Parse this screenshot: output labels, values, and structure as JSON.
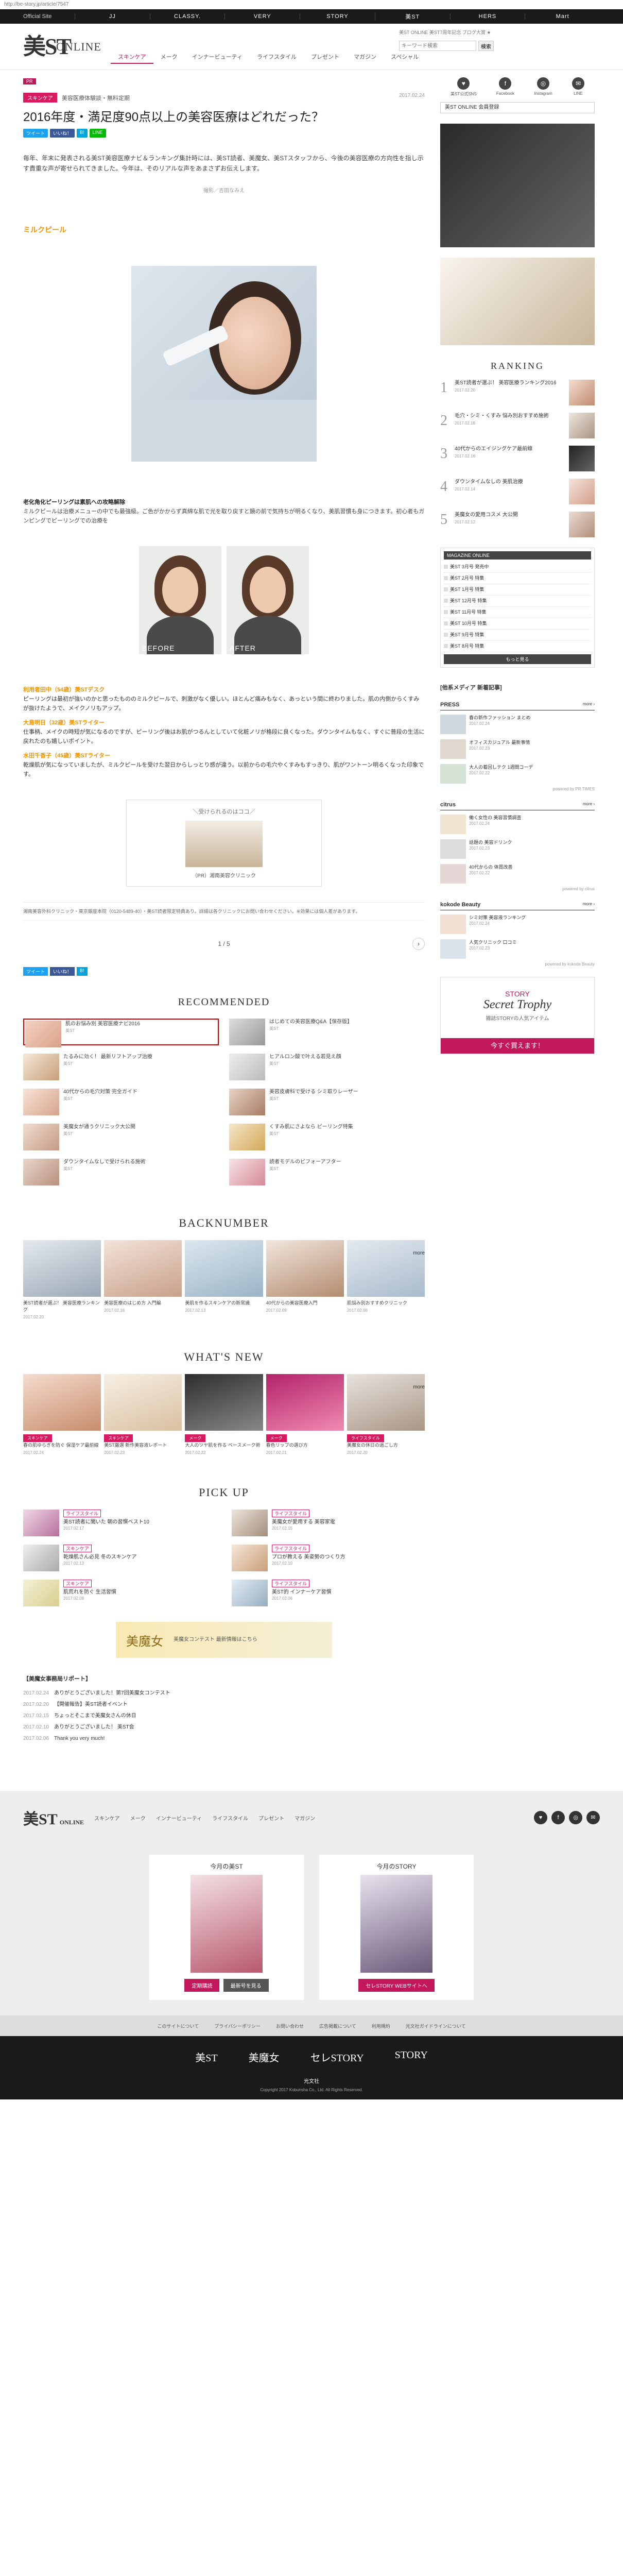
{
  "url": "http://be-story.jp/article/7547",
  "globalnav": {
    "official": "Official Site",
    "items": [
      "JJ",
      "CLASSY.",
      "VERY",
      "STORY",
      "美ST",
      "HERS",
      "Mart"
    ]
  },
  "header": {
    "logo_main": "美ST",
    "logo_sub": "ONLINE",
    "tagline": "美ST ONLINE 美ST7周年記念 ブログ大賞 ★",
    "nav": [
      "スキンケア",
      "メーク",
      "インナービューティ",
      "ライフスタイル",
      "プレゼント",
      "マガジン",
      "スペシャル"
    ],
    "search_placeholder": "キーワード検索",
    "search_button": "検索"
  },
  "article": {
    "badge": "PR",
    "category": "スキンケア",
    "category_sub": "美容医療体験談・無料定期",
    "date": "2017.02.24",
    "title": "2016年度・満足度90点以上の美容医療はどれだった？",
    "share": [
      "ツイート",
      "いいね！",
      "B!",
      "LINE"
    ],
    "lead": "毎年、年末に発表される美ST美容医療ナビ＆ランキング集計時には、美ST読者、美魔女、美STスタッフから、今後の美容医療の方向性を指し示す貴重な声が寄せられてきました。今年は、そのリアルな声をあまさずお伝えします。",
    "credit": "撮影／吉田なみえ",
    "section": "ミルクピール",
    "body_head": "老化角化ピーリングは素肌への攻略解除",
    "body": "ミルクピールは治療メニューの中でも最強級。ご色がかからず真綿な肌で光を取り戻すと鏡の前で気持ちが明るくなり、美肌習慣も身につきます。初心者もガンピングでピーリングでの治療を",
    "before": "BEFORE",
    "after": "AFTER",
    "comments": [
      {
        "who": "利用者田中（54歳）美STデスク",
        "text": "ピーリングは最初が強いのかと思ったもののミルクピールで、刺激がなく優しい。ほとんど痛みもなく、あっという間に終わりました。肌の内側からくすみが抜けたようで、メイクノリもアップ。"
      },
      {
        "who": "大島明日（32歳）美STライター",
        "text": "仕事柄、メイクの時短が気になるのですが、ピーリング後はお肌がつるんとしていて化粧ノリが格段に良くなった。ダウンタイムもなく、すぐに普段の生活に戻れたのも嬉しいポイント。"
      },
      {
        "who": "水田千香子（45歳）美STライター",
        "text": "乾燥肌が気になっていましたが、ミルクピールを受けた翌日からしっとり感が違う。以前からの毛穴やくすみもすっきり、肌がワントーン明るくなった印象です。"
      }
    ],
    "clinic_title": "＼受けられるのはココ／",
    "clinic_name": "（PR）湘南美容クリニック",
    "note": "湘南美容外科クリニック・東京銀座本院（0120-5489-40）・美ST読者限定特典あり。詳細は各クリニックにお問い合わせください。※効果には個人差があります。",
    "page": "1 / 5"
  },
  "recommended": {
    "title": "RECOMMENDED",
    "items": [
      {
        "text": "肌のお悩み別 美容医療ナビ2016",
        "src": "美ST"
      },
      {
        "text": "はじめての美容医療Q&A【保存版】",
        "src": "美ST"
      },
      {
        "text": "たるみに効く！ 最新リフトアップ治療",
        "src": "美ST"
      },
      {
        "text": "ヒアルロン酸で叶える若見え顔",
        "src": "美ST"
      },
      {
        "text": "40代からの毛穴対策 完全ガイド",
        "src": "美ST"
      },
      {
        "text": "美容皮膚科で受ける シミ取りレーザー",
        "src": "美ST"
      },
      {
        "text": "美魔女が通うクリニック大公開",
        "src": "美ST"
      },
      {
        "text": "くすみ肌にさよなら ピーリング特集",
        "src": "美ST"
      },
      {
        "text": "ダウンタイムなしで受けられる施術",
        "src": "美ST"
      },
      {
        "text": "読者モデルのビフォーアフター",
        "src": "美ST"
      }
    ]
  },
  "backnumber": {
    "title": "BACKNUMBER",
    "more": "more",
    "items": [
      {
        "text": "美ST読者が選ぶ！ 美容医療ランキング",
        "date": "2017.02.20"
      },
      {
        "text": "美容医療のはじめ方 入門編",
        "date": "2017.02.16"
      },
      {
        "text": "美肌を作るスキンケアの新常識",
        "date": "2017.02.13"
      },
      {
        "text": "40代からの美容医療入門",
        "date": "2017.02.09"
      },
      {
        "text": "肌悩み別おすすめクリニック",
        "date": "2017.02.06"
      }
    ]
  },
  "whatsnew": {
    "title": "WHAT'S NEW",
    "more": "more",
    "items": [
      {
        "label": "スキンケア",
        "text": "春の肌ゆらぎを防ぐ 保湿ケア最前線",
        "date": "2017.02.24"
      },
      {
        "label": "スキンケア",
        "text": "美ST厳選 新作美容液レポート",
        "date": "2017.02.23"
      },
      {
        "label": "メーク",
        "text": "大人のツヤ肌を作る ベースメーク術",
        "date": "2017.02.22"
      },
      {
        "label": "メーク",
        "text": "春色リップの選び方",
        "date": "2017.02.21"
      },
      {
        "label": "ライフスタイル",
        "text": "美魔女の休日の過ごし方",
        "date": "2017.02.20"
      }
    ]
  },
  "pickup": {
    "title": "PICK UP",
    "items": [
      {
        "label": "ライフスタイル",
        "text": "美ST読者に聞いた 朝の習慣ベスト10",
        "date": "2017.02.17"
      },
      {
        "label": "ライフスタイル",
        "text": "美魔女が愛用する 美容家電",
        "date": "2017.02.15"
      },
      {
        "label": "スキンケア",
        "text": "乾燥肌さん必見 冬のスキンケア",
        "date": "2017.02.13"
      },
      {
        "label": "ライフスタイル",
        "text": "プロが教える 美姿勢のつくり方",
        "date": "2017.02.10"
      },
      {
        "label": "スキンケア",
        "text": "肌荒れを防ぐ 生活習慣",
        "date": "2017.02.08"
      },
      {
        "label": "ライフスタイル",
        "text": "美ST的 インナーケア習慣",
        "date": "2017.02.06"
      }
    ]
  },
  "banner": {
    "logo": "美魔女",
    "text": "美魔女コンテスト 最新情報はこちら"
  },
  "news": {
    "title": "【美魔女事務局リポート】",
    "items": [
      {
        "date": "2017.02.24",
        "text": "ありがとうございました！第7回美魔女コンテスト"
      },
      {
        "date": "2017.02.20",
        "text": "【開催報告】美ST読者イベント"
      },
      {
        "date": "2017.02.15",
        "text": "ちょっとそこまで美魔女さんの休日"
      },
      {
        "date": "2017.02.10",
        "text": "ありがとうございました！ 美ST会"
      },
      {
        "date": "2017.02.06",
        "text": "Thank you very much!"
      }
    ]
  },
  "sidebar": {
    "nav": [
      {
        "icon": "♥",
        "label": "美ST公式SNS"
      },
      {
        "icon": "f",
        "label": "Facebook"
      },
      {
        "icon": "◎",
        "label": "Instagram"
      },
      {
        "icon": "✉",
        "label": "LINE"
      }
    ],
    "subscribe": "美ST ONLINE 会員登録",
    "ranking_title": "RANKING",
    "ranking": [
      {
        "n": "1",
        "text": "美ST読者が選ぶ！ 美容医療ランキング2016",
        "date": "2017.02.20"
      },
      {
        "n": "2",
        "text": "毛穴・シミ・くすみ 悩み別おすすめ施術",
        "date": "2017.02.18"
      },
      {
        "n": "3",
        "text": "40代からのエイジングケア最前線",
        "date": "2017.02.16"
      },
      {
        "n": "4",
        "text": "ダウンタイムなしの 美肌治療",
        "date": "2017.02.14"
      },
      {
        "n": "5",
        "text": "美魔女の愛用コスメ 大公開",
        "date": "2017.02.12"
      }
    ],
    "box_title": "MAGAZINE ONLINE",
    "box_items": [
      "美ST 3月号 発売中",
      "美ST 2月号 特集",
      "美ST 1月号 特集",
      "美ST 12月号 特集",
      "美ST 11月号 特集",
      "美ST 10月号 特集",
      "美ST 9月号 特集",
      "美ST 8月号 特集"
    ],
    "box_more": "もっと見る",
    "media_title": "[他系メディア 新着記事]",
    "press_title": "PRESS",
    "press_items": [
      {
        "text": "春の新作ファッション まとめ",
        "date": "2017.02.24"
      },
      {
        "text": "オフィスカジュアル 最新事情",
        "date": "2017.02.23"
      },
      {
        "text": "大人の着回しテク 1週間コーデ",
        "date": "2017.02.22"
      }
    ],
    "press_powered": "powered by PR TIMES",
    "citrus_title": "citrus",
    "citrus_items": [
      {
        "text": "働く女性の 美容習慣調査",
        "date": "2017.02.24"
      },
      {
        "text": "話題の 美容ドリンク",
        "date": "2017.02.23"
      },
      {
        "text": "40代からの 体質改善",
        "date": "2017.02.22"
      }
    ],
    "citrus_powered": "powered by citrus",
    "kokode_title": "kokode Beauty",
    "kokode_items": [
      {
        "text": "シミ対策 美容液ランキング",
        "date": "2017.02.24"
      },
      {
        "text": "人気クリニック 口コミ",
        "date": "2017.02.23"
      }
    ],
    "kokode_powered": "powered by kokode Beauty",
    "secret_sub": "STORY",
    "secret_main": "Secret Trophy",
    "secret_desc": "雑誌STORYの人気アイテム",
    "secret_btn": "今すぐ買えます！"
  },
  "footer": {
    "logo": "美ST",
    "logo_sub": "ONLINE",
    "nav": [
      "スキンケア",
      "メーク",
      "インナービューティ",
      "ライフスタイル",
      "プレゼント",
      "マガジン"
    ],
    "social": [
      "♥",
      "f",
      "◎",
      "✉"
    ],
    "mag1_title": "今月の美ST",
    "mag1_btns": [
      "定期購読",
      "最新号を見る"
    ],
    "mag2_title": "今月のSTORY",
    "mag2_btns": [
      "セレSTORY WEBサイトへ"
    ],
    "links": [
      "このサイトについて",
      "プライバシーポリシー",
      "お問い合わせ",
      "広告掲載について",
      "利用規約",
      "光文社ガイドラインについて"
    ],
    "brands": [
      "美ST",
      "美魔女",
      "セレSTORY",
      "STORY"
    ],
    "publisher": "光文社",
    "copyright": "Copyright 2017 Kobunsha Co., Ltd. All Rights Reserved."
  }
}
